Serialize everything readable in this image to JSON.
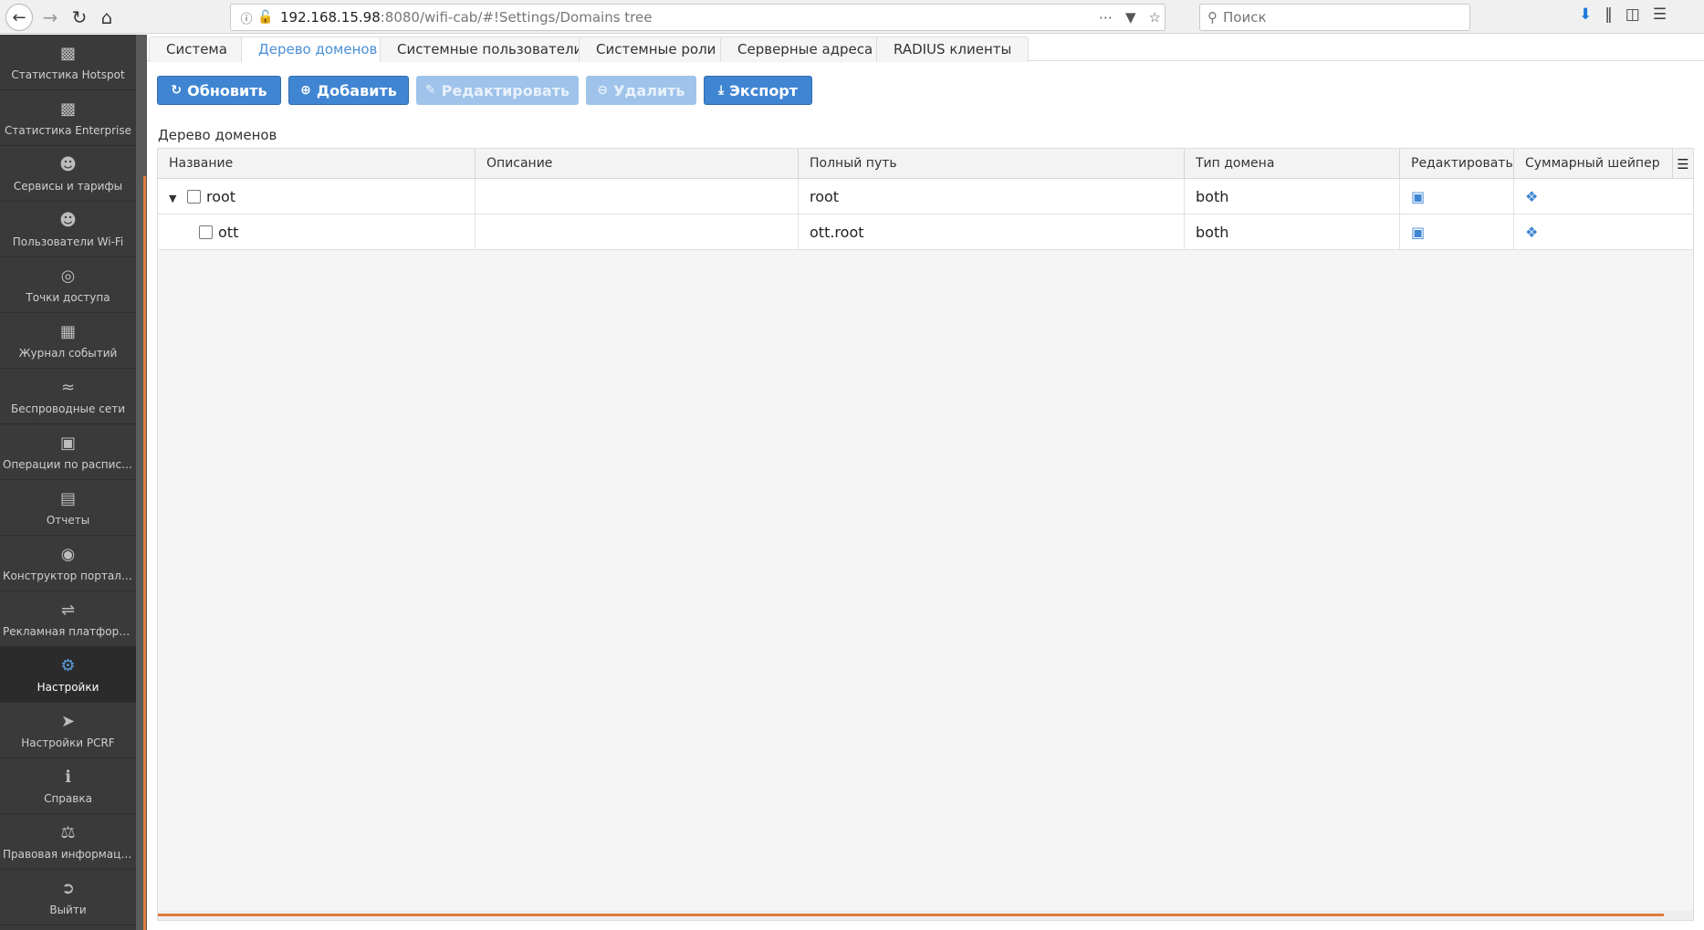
{
  "browser": {
    "url_host": "192.168.15.98",
    "url_rest": ":8080/wifi-cab/#!Settings/Domains tree",
    "search_placeholder": "Поиск"
  },
  "sidebar": {
    "items": [
      {
        "label": "Статистика Hotspot",
        "icon": "bar-chart-icon"
      },
      {
        "label": "Статистика Enterprise",
        "icon": "bar-chart-icon"
      },
      {
        "label": "Сервисы и тарифы",
        "icon": "users-icon"
      },
      {
        "label": "Пользователи Wi-Fi",
        "icon": "users-icon"
      },
      {
        "label": "Точки доступа",
        "icon": "target-icon"
      },
      {
        "label": "Журнал событий",
        "icon": "table-icon"
      },
      {
        "label": "Беспроводные сети",
        "icon": "wifi-icon"
      },
      {
        "label": "Операции по расписа...",
        "icon": "calendar-icon"
      },
      {
        "label": "Отчеты",
        "icon": "document-icon"
      },
      {
        "label": "Конструктор порталов",
        "icon": "globe-icon"
      },
      {
        "label": "Рекламная платформа",
        "icon": "ad-icon"
      },
      {
        "label": "Настройки",
        "icon": "gear-icon",
        "active": true
      },
      {
        "label": "Настройки PCRF",
        "icon": "rocket-icon"
      },
      {
        "label": "Справка",
        "icon": "info-icon"
      },
      {
        "label": "Правовая информация",
        "icon": "balance-scale-icon"
      },
      {
        "label": "Выйти",
        "icon": "sign-out-icon"
      }
    ]
  },
  "tabs": [
    {
      "label": "Система"
    },
    {
      "label": "Дерево доменов",
      "active": true
    },
    {
      "label": "Системные пользователи"
    },
    {
      "label": "Системные роли"
    },
    {
      "label": "Серверные адреса"
    },
    {
      "label": "RADIUS клиенты"
    }
  ],
  "toolbar": {
    "refresh_label": "Обновить",
    "add_label": "Добавить",
    "edit_label": "Редактировать",
    "delete_label": "Удалить",
    "export_label": "Экспорт"
  },
  "section_title": "Дерево доменов",
  "grid": {
    "columns": [
      "Название",
      "Описание",
      "Полный путь",
      "Тип домена",
      "Редактировать",
      "Суммарный шейпер"
    ],
    "rows": [
      {
        "name": "root",
        "description": "",
        "full_path": "root",
        "domain_type": "both",
        "expanded": true,
        "level": 0
      },
      {
        "name": "ott",
        "description": "",
        "full_path": "ott.root",
        "domain_type": "both",
        "level": 1
      }
    ]
  },
  "colors": {
    "sidebar_bg": "#3a3a3a",
    "accent_blue": "#3f85d2",
    "accent_orange": "#e07b3e"
  }
}
